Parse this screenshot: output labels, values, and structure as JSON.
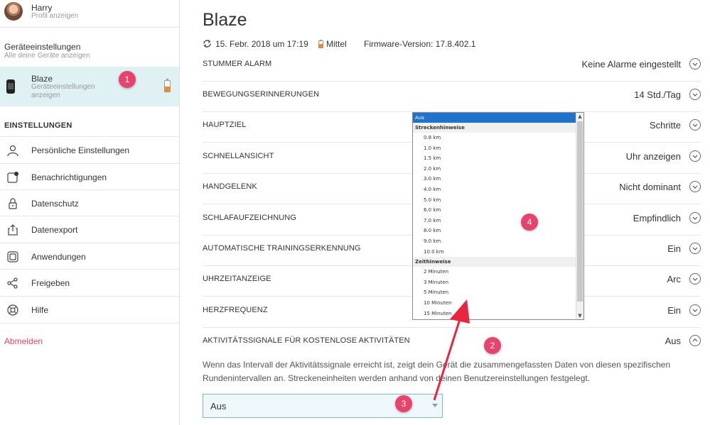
{
  "profile": {
    "name": "Harry",
    "subtitle": "Profil anzeigen"
  },
  "devices": {
    "heading": "Geräteeinstellungen",
    "subtitle": "Alle deine Geräte anzeigen"
  },
  "device": {
    "name": "Blaze",
    "subtitle": "Geräteeinstellungen anzeigen",
    "battery_level": 0.45,
    "battery_color": "#f18b20"
  },
  "settings_heading": "EINSTELLUNGEN",
  "nav": [
    {
      "label": "Persönliche Einstellungen",
      "icon": "person-icon"
    },
    {
      "label": "Benachrichtigungen",
      "icon": "notification-icon"
    },
    {
      "label": "Datenschutz",
      "icon": "lock-icon"
    },
    {
      "label": "Datenexport",
      "icon": "export-icon"
    },
    {
      "label": "Anwendungen",
      "icon": "apps-icon"
    },
    {
      "label": "Freigeben",
      "icon": "share-icon"
    },
    {
      "label": "Hilfe",
      "icon": "help-icon"
    }
  ],
  "logout": "Abmelden",
  "main": {
    "title": "Blaze",
    "sync": "15. Febr. 2018 um 17:19",
    "battery": "Mittel",
    "firmware": "Firmware-Version: 17.8.402.1"
  },
  "settings_rows": [
    {
      "label": "STUMMER ALARM",
      "value": "Keine Alarme eingestellt"
    },
    {
      "label": "BEWEGUNGSERINNERUNGEN",
      "value": "14 Std./Tag"
    },
    {
      "label": "HAUPTZIEL",
      "value": "Schritte"
    },
    {
      "label": "SCHNELLANSICHT",
      "value": "Uhr anzeigen"
    },
    {
      "label": "HANDGELENK",
      "value": "Nicht dominant"
    },
    {
      "label": "SCHLAFAUFZEICHNUNG",
      "value": "Empfindlich"
    },
    {
      "label": "AUTOMATISCHE TRAININGSERKENNUNG",
      "value": "Ein"
    },
    {
      "label": "UHRZEITANZEIGE",
      "value": "Arc"
    },
    {
      "label": "HERZFREQUENZ",
      "value": "Ein"
    },
    {
      "label": "AKTIVITÄTSSIGNALE FÜR KOSTENLOSE AKTIVITÄTEN",
      "value": "Aus"
    }
  ],
  "description": "Wenn das Intervall der Aktivitätssignale erreicht ist, zeigt dein Gerät die zusammengefassten Daten von diesen spezifischen Rundenintervallen an. Streckeneinheiten werden anhand von deinen Benutzereinstellungen festgelegt.",
  "select": {
    "value": "Aus"
  },
  "dropdown": {
    "selected": "Aus",
    "group1": "Streckenhinweise",
    "distance_options": [
      "0.8 km",
      "1.0 km",
      "1.5 km",
      "2.0 km",
      "3.0 km",
      "4.0 km",
      "5.0 km",
      "6.0 km",
      "7.0 km",
      "8.0 km",
      "9.0 km",
      "10.0 km"
    ],
    "group2": "Zeithinweise",
    "time_options": [
      "2 Minuten",
      "3 Minuten",
      "5 Minuten",
      "10 Minuten",
      "15 Minuten"
    ]
  },
  "markers": [
    "1",
    "2",
    "3",
    "4"
  ],
  "colors": {
    "accent": "#e8436c",
    "selected_bg": "#dff1f3",
    "select_border": "#7ab9c2",
    "arrow": "#e8263f"
  }
}
